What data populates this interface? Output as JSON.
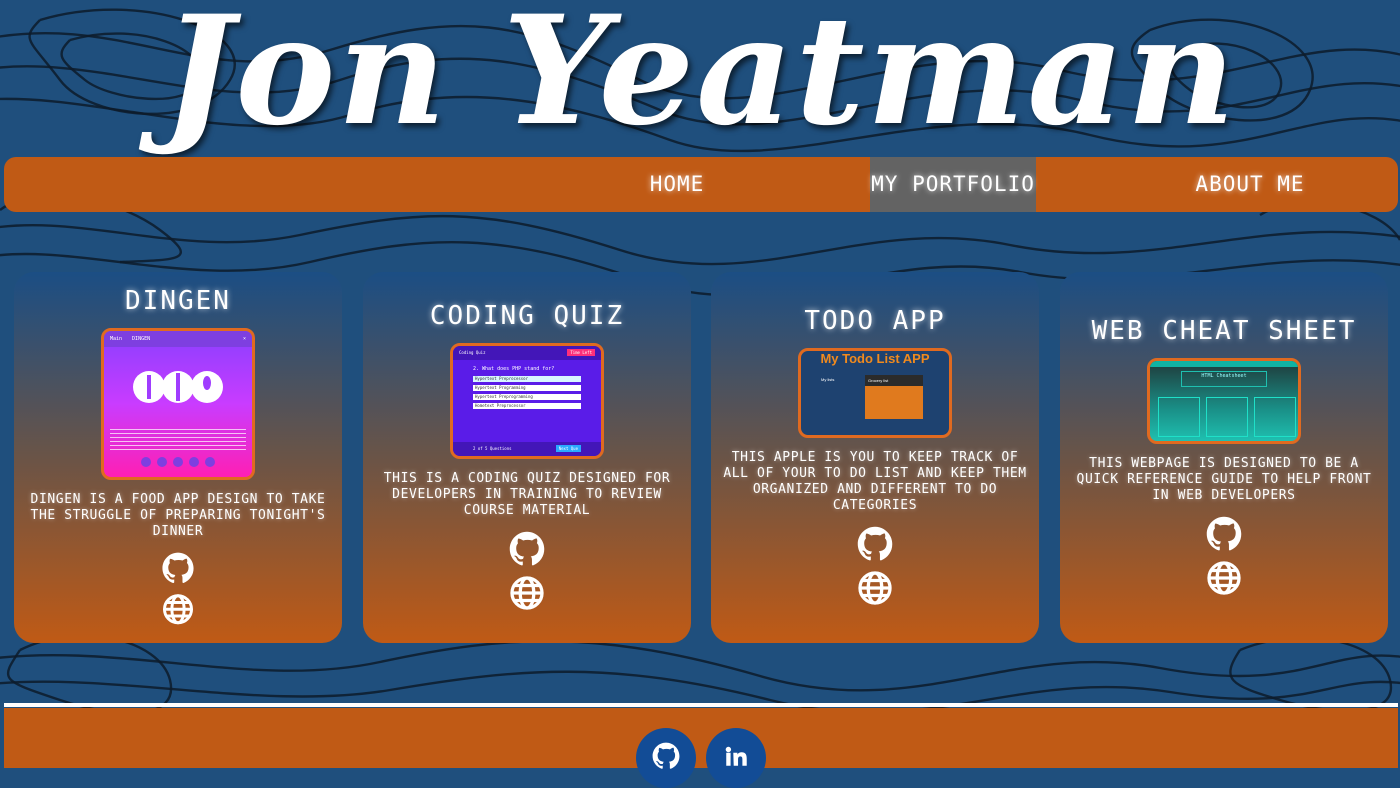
{
  "site_title": "Jon Yeatman",
  "nav": {
    "home": "Home",
    "portfolio": "My Portfolio",
    "about": "About Me"
  },
  "projects": [
    {
      "title": "DINGEN",
      "description": "DINGEN is a food app design to take the struggle of preparing tonight's dinner",
      "thumbnail": {
        "header_brand": "Main",
        "header_title": "DINGEN",
        "header_close": "×"
      }
    },
    {
      "title": "Coding Quiz",
      "description": "This is a coding quiz designed for developers in training to review course material",
      "thumbnail": {
        "top_label": "Coding Quiz",
        "top_button": "Time Left",
        "question": "2. What does PHP stand for?",
        "answers": [
          "Hypertext Preprocessor",
          "Hypertext Programming",
          "Hypertext Preprogramming",
          "Hometext Preprocessor"
        ],
        "footer_left": "2 of 5 Questions",
        "footer_button": "Next Que"
      }
    },
    {
      "title": "Todo App",
      "description": "This Apple is you to keep track of all of your to do list and keep them organized and different to do categories",
      "thumbnail": {
        "heading": "My Todo List APP",
        "left_panel": "My lists",
        "right_panel": "Grocery list"
      }
    },
    {
      "title": "Web Cheat Sheet",
      "description": "This webpage is designed to be a quick reference guide to help front in web developers",
      "thumbnail": {
        "heading": "HTML Cheatsheet"
      }
    }
  ],
  "icons": {
    "github": "github-icon",
    "website": "globe-icon",
    "linkedin": "linkedin-icon"
  },
  "colors": {
    "accent": "#c05a15",
    "active_nav": "#636363",
    "background": "#1f4f7d",
    "social_button": "#124c96"
  }
}
